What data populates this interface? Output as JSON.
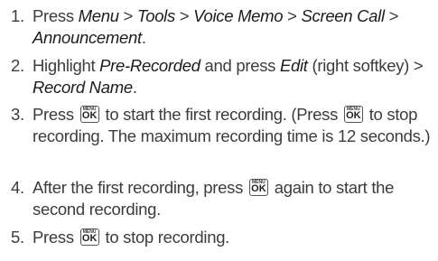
{
  "key_icon": {
    "top": "MENU",
    "main": "OK"
  },
  "steps": [
    {
      "num": "1.",
      "parts": [
        {
          "t": "Press "
        },
        {
          "t": "Menu",
          "em": true
        },
        {
          "t": " > "
        },
        {
          "t": "Tools",
          "em": true
        },
        {
          "t": " > "
        },
        {
          "t": "Voice Memo",
          "em": true
        },
        {
          "t": " > "
        },
        {
          "t": "Screen Call",
          "em": true
        },
        {
          "t": " > "
        },
        {
          "t": "Announcement",
          "em": true
        },
        {
          "t": "."
        }
      ]
    },
    {
      "num": "2.",
      "parts": [
        {
          "t": "Highlight "
        },
        {
          "t": "Pre-Recorded",
          "em": true
        },
        {
          "t": " and press "
        },
        {
          "t": "Edit",
          "em": true
        },
        {
          "t": " (right softkey) > "
        },
        {
          "t": "Record Name",
          "em": true
        },
        {
          "t": "."
        }
      ]
    },
    {
      "num": "3.",
      "parts": [
        {
          "t": "Press "
        },
        {
          "key": true
        },
        {
          "t": " to start the first recording. (Press "
        },
        {
          "key": true
        },
        {
          "t": " to stop recording. The maximum recording time is 12 seconds.)"
        }
      ]
    },
    {
      "num": "4.",
      "parts": [
        {
          "t": "After the first recording, press "
        },
        {
          "key": true
        },
        {
          "t": " again to start the second recording."
        }
      ]
    },
    {
      "num": "5.",
      "parts": [
        {
          "t": "Press "
        },
        {
          "key": true
        },
        {
          "t": " to stop recording."
        }
      ]
    }
  ]
}
